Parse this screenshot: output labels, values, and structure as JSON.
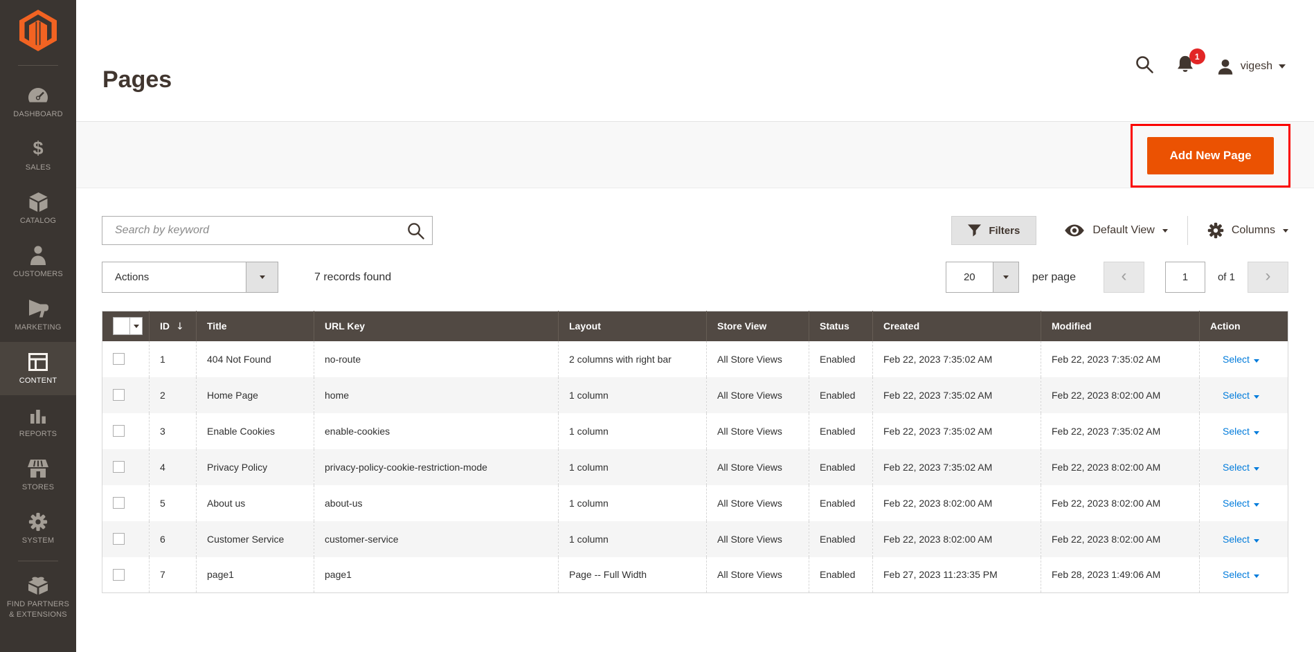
{
  "sidebar": {
    "items": [
      {
        "label": "DASHBOARD",
        "icon": "dashboard-icon"
      },
      {
        "label": "SALES",
        "icon": "sales-icon"
      },
      {
        "label": "CATALOG",
        "icon": "catalog-icon"
      },
      {
        "label": "CUSTOMERS",
        "icon": "customers-icon"
      },
      {
        "label": "MARKETING",
        "icon": "marketing-icon"
      },
      {
        "label": "CONTENT",
        "icon": "content-icon",
        "active": true
      },
      {
        "label": "REPORTS",
        "icon": "reports-icon"
      },
      {
        "label": "STORES",
        "icon": "stores-icon"
      },
      {
        "label": "SYSTEM",
        "icon": "system-icon"
      },
      {
        "label": "FIND PARTNERS\n& EXTENSIONS",
        "icon": "extensions-icon"
      }
    ]
  },
  "header": {
    "title": "Pages",
    "notification_count": "1",
    "username": "vigesh"
  },
  "toolbar": {
    "add_button_label": "Add New Page"
  },
  "grid_controls": {
    "search_placeholder": "Search by keyword",
    "filters_label": "Filters",
    "view_label": "Default View",
    "columns_label": "Columns"
  },
  "grid_toolbar": {
    "actions_label": "Actions",
    "records_found": "7 records found",
    "per_page_value": "20",
    "per_page_label": "per page",
    "prev_glyph": "‹",
    "next_glyph": "›",
    "current_page": "1",
    "total_pages_label": "of 1"
  },
  "table": {
    "sort_indicator": "↓",
    "columns": [
      "ID",
      "Title",
      "URL Key",
      "Layout",
      "Store View",
      "Status",
      "Created",
      "Modified",
      "Action"
    ],
    "rows": [
      {
        "id": "1",
        "title": "404 Not Found",
        "url_key": "no-route",
        "layout": "2 columns with right bar",
        "store_view": "All Store Views",
        "status": "Enabled",
        "created": "Feb 22, 2023 7:35:02 AM",
        "modified": "Feb 22, 2023 7:35:02 AM",
        "action": "Select"
      },
      {
        "id": "2",
        "title": "Home Page",
        "url_key": "home",
        "layout": "1 column",
        "store_view": "All Store Views",
        "status": "Enabled",
        "created": "Feb 22, 2023 7:35:02 AM",
        "modified": "Feb 22, 2023 8:02:00 AM",
        "action": "Select"
      },
      {
        "id": "3",
        "title": "Enable Cookies",
        "url_key": "enable-cookies",
        "layout": "1 column",
        "store_view": "All Store Views",
        "status": "Enabled",
        "created": "Feb 22, 2023 7:35:02 AM",
        "modified": "Feb 22, 2023 7:35:02 AM",
        "action": "Select"
      },
      {
        "id": "4",
        "title": "Privacy Policy",
        "url_key": "privacy-policy-cookie-restriction-mode",
        "layout": "1 column",
        "store_view": "All Store Views",
        "status": "Enabled",
        "created": "Feb 22, 2023 7:35:02 AM",
        "modified": "Feb 22, 2023 8:02:00 AM",
        "action": "Select"
      },
      {
        "id": "5",
        "title": "About us",
        "url_key": "about-us",
        "layout": "1 column",
        "store_view": "All Store Views",
        "status": "Enabled",
        "created": "Feb 22, 2023 8:02:00 AM",
        "modified": "Feb 22, 2023 8:02:00 AM",
        "action": "Select"
      },
      {
        "id": "6",
        "title": "Customer Service",
        "url_key": "customer-service",
        "layout": "1 column",
        "store_view": "All Store Views",
        "status": "Enabled",
        "created": "Feb 22, 2023 8:02:00 AM",
        "modified": "Feb 22, 2023 8:02:00 AM",
        "action": "Select"
      },
      {
        "id": "7",
        "title": "page1",
        "url_key": "page1",
        "layout": "Page -- Full Width",
        "store_view": "All Store Views",
        "status": "Enabled",
        "created": "Feb 27, 2023 11:23:35 PM",
        "modified": "Feb 28, 2023 1:49:06 AM",
        "action": "Select"
      }
    ]
  },
  "colors": {
    "sidebar_bg": "#3a3531",
    "sidebar_active_bg": "#4a443e",
    "accent_orange": "#eb5202",
    "badge_red": "#e22626",
    "link_blue": "#007bdb",
    "table_header_bg": "#514943",
    "annotation_red": "#fb0400"
  }
}
